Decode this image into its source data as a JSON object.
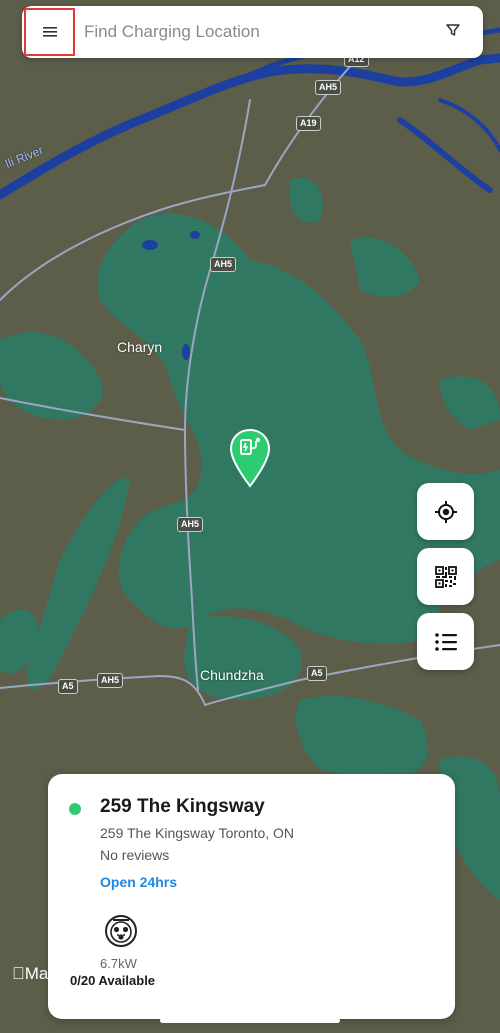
{
  "search": {
    "placeholder": "Find Charging Location"
  },
  "icons": {
    "menu": "hamburger-menu-icon",
    "filter": "filter-funnel-icon",
    "locate": "crosshair-target-icon",
    "qr": "qr-code-icon",
    "list": "list-icon",
    "pin": "ev-charger-pin-icon",
    "connector": "j1772-connector-icon"
  },
  "map": {
    "labels": {
      "river": "Ili River",
      "town1": "Charyn",
      "town2": "Chundzha",
      "apple_maps": "Ma"
    },
    "shields": {
      "a12": "A12",
      "ah5_top": "AH5",
      "a19": "A19",
      "ah5_mid": "AH5",
      "ah5_low": "AH5",
      "a5_left": "A5",
      "ah5_left": "AH5",
      "a5_right": "A5"
    }
  },
  "station": {
    "name": "259 The Kingsway",
    "address": "259 The Kingsway Toronto, ON",
    "reviews": "No reviews",
    "hours": "Open 24hrs",
    "power": "6.7kW",
    "availability": "0/20 Available"
  },
  "colors": {
    "accent_green": "#2ecc71",
    "link_blue": "#1e88e5",
    "highlight_red": "#e53935",
    "map_land": "#5c5e4a",
    "map_forest": "#2f7a64",
    "map_water": "#1d3fa0"
  }
}
